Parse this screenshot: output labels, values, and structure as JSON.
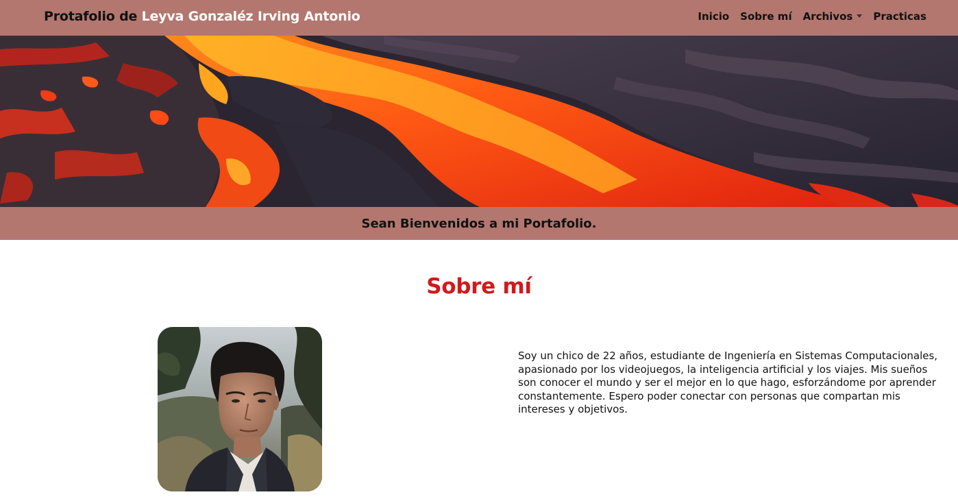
{
  "navbar": {
    "brand_prefix": "Protafolio de ",
    "brand_name": "Leyva Gonzaléz Irving Antonio",
    "links": [
      {
        "label": "Inicio"
      },
      {
        "label": "Sobre mí"
      },
      {
        "label": "Archivos",
        "dropdown": true
      },
      {
        "label": "Practicas"
      }
    ],
    "bg_color": "#b3776f"
  },
  "hero": {
    "image": "lava-flow-banner"
  },
  "welcome": {
    "text": "Sean Bienvenidos a mi Portafolio."
  },
  "about": {
    "title": "Sobre mí",
    "title_color": "#d1191c",
    "photo": "profile-portrait",
    "text": "Soy un chico de 22 años, estudiante de Ingeniería en Sistemas Computacionales, apasionado por los videojuegos, la inteligencia artificial y los viajes. Mis sueños son conocer el mundo y ser el mejor en lo que hago, esforzándome por aprender constantemente. Espero poder conectar con personas que compartan mis intereses y objetivos."
  }
}
